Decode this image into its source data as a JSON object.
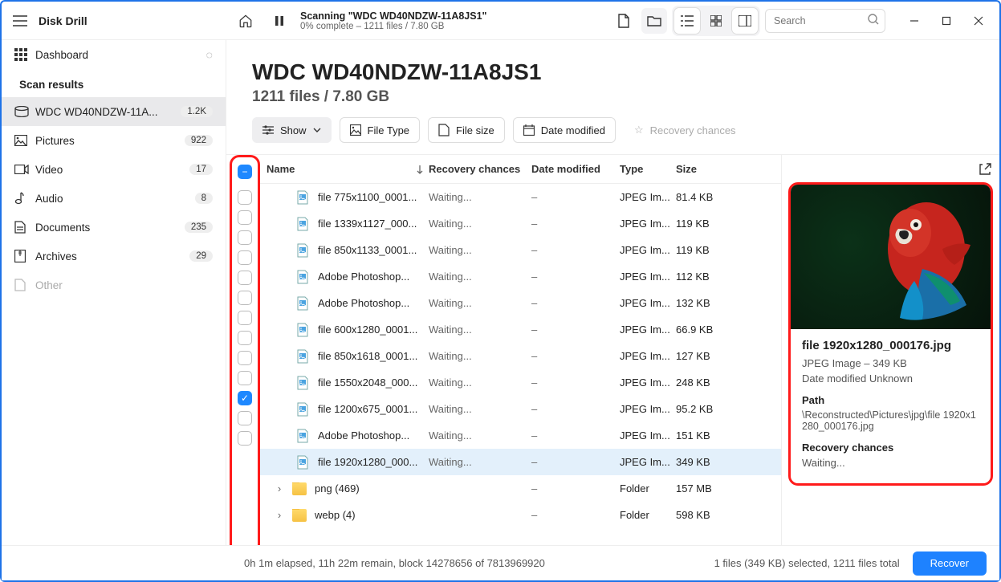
{
  "app_name": "Disk Drill",
  "scan_title": "Scanning \"WDC WD40NDZW-11A8JS1\"",
  "scan_sub": "0% complete – 1211 files / 7.80 GB",
  "search_placeholder": "Search",
  "sidebar": {
    "dashboard": "Dashboard",
    "scan_results": "Scan results",
    "items": [
      {
        "icon": "drive",
        "label": "WDC WD40NDZW-11A...",
        "badge": "1.2K",
        "active": true
      },
      {
        "icon": "image",
        "label": "Pictures",
        "badge": "922"
      },
      {
        "icon": "video",
        "label": "Video",
        "badge": "17"
      },
      {
        "icon": "audio",
        "label": "Audio",
        "badge": "8"
      },
      {
        "icon": "doc",
        "label": "Documents",
        "badge": "235"
      },
      {
        "icon": "archive",
        "label": "Archives",
        "badge": "29"
      },
      {
        "icon": "other",
        "label": "Other",
        "badge": ""
      }
    ],
    "explorer_btn": "Show scan results in Explorer"
  },
  "page_title": "WDC WD40NDZW-11A8JS1",
  "page_sub": "1211 files / 7.80 GB",
  "toolbar": {
    "show": "Show",
    "filetype": "File Type",
    "filesize": "File size",
    "datemod": "Date modified",
    "recchance": "Recovery chances"
  },
  "columns": {
    "name": "Name",
    "rec": "Recovery chances",
    "date": "Date modified",
    "type": "Type",
    "size": "Size"
  },
  "rows": [
    {
      "name": "file 775x1100_0001...",
      "rec": "Waiting...",
      "dm": "–",
      "type": "JPEG Im...",
      "size": "81.4 KB"
    },
    {
      "name": "file 1339x1127_000...",
      "rec": "Waiting...",
      "dm": "–",
      "type": "JPEG Im...",
      "size": "119 KB"
    },
    {
      "name": "file 850x1133_0001...",
      "rec": "Waiting...",
      "dm": "–",
      "type": "JPEG Im...",
      "size": "119 KB"
    },
    {
      "name": "Adobe Photoshop...",
      "rec": "Waiting...",
      "dm": "–",
      "type": "JPEG Im...",
      "size": "112 KB"
    },
    {
      "name": "Adobe Photoshop...",
      "rec": "Waiting...",
      "dm": "–",
      "type": "JPEG Im...",
      "size": "132 KB"
    },
    {
      "name": "file 600x1280_0001...",
      "rec": "Waiting...",
      "dm": "–",
      "type": "JPEG Im...",
      "size": "66.9 KB"
    },
    {
      "name": "file 850x1618_0001...",
      "rec": "Waiting...",
      "dm": "–",
      "type": "JPEG Im...",
      "size": "127 KB"
    },
    {
      "name": "file 1550x2048_000...",
      "rec": "Waiting...",
      "dm": "–",
      "type": "JPEG Im...",
      "size": "248 KB"
    },
    {
      "name": "file 1200x675_0001...",
      "rec": "Waiting...",
      "dm": "–",
      "type": "JPEG Im...",
      "size": "95.2 KB"
    },
    {
      "name": "Adobe Photoshop...",
      "rec": "Waiting...",
      "dm": "–",
      "type": "JPEG Im...",
      "size": "151 KB"
    },
    {
      "name": "file 1920x1280_000...",
      "rec": "Waiting...",
      "dm": "–",
      "type": "JPEG Im...",
      "size": "349 KB",
      "selected": true
    },
    {
      "name": "png (469)",
      "rec": "",
      "dm": "–",
      "type": "Folder",
      "size": "157 MB",
      "folder": true
    },
    {
      "name": "webp (4)",
      "rec": "",
      "dm": "–",
      "type": "Folder",
      "size": "598 KB",
      "folder": true
    }
  ],
  "preview": {
    "filename": "file 1920x1280_000176.jpg",
    "meta": "JPEG Image – 349 KB",
    "datemod": "Date modified Unknown",
    "path_label": "Path",
    "path": "\\Reconstructed\\Pictures\\jpg\\file 1920x1280_000176.jpg",
    "rec_label": "Recovery chances",
    "rec_value": "Waiting..."
  },
  "status": {
    "left": "0h 1m elapsed, 11h 22m remain, block 14278656 of 7813969920",
    "right": "1 files (349 KB) selected, 1211 files total",
    "recover": "Recover"
  }
}
